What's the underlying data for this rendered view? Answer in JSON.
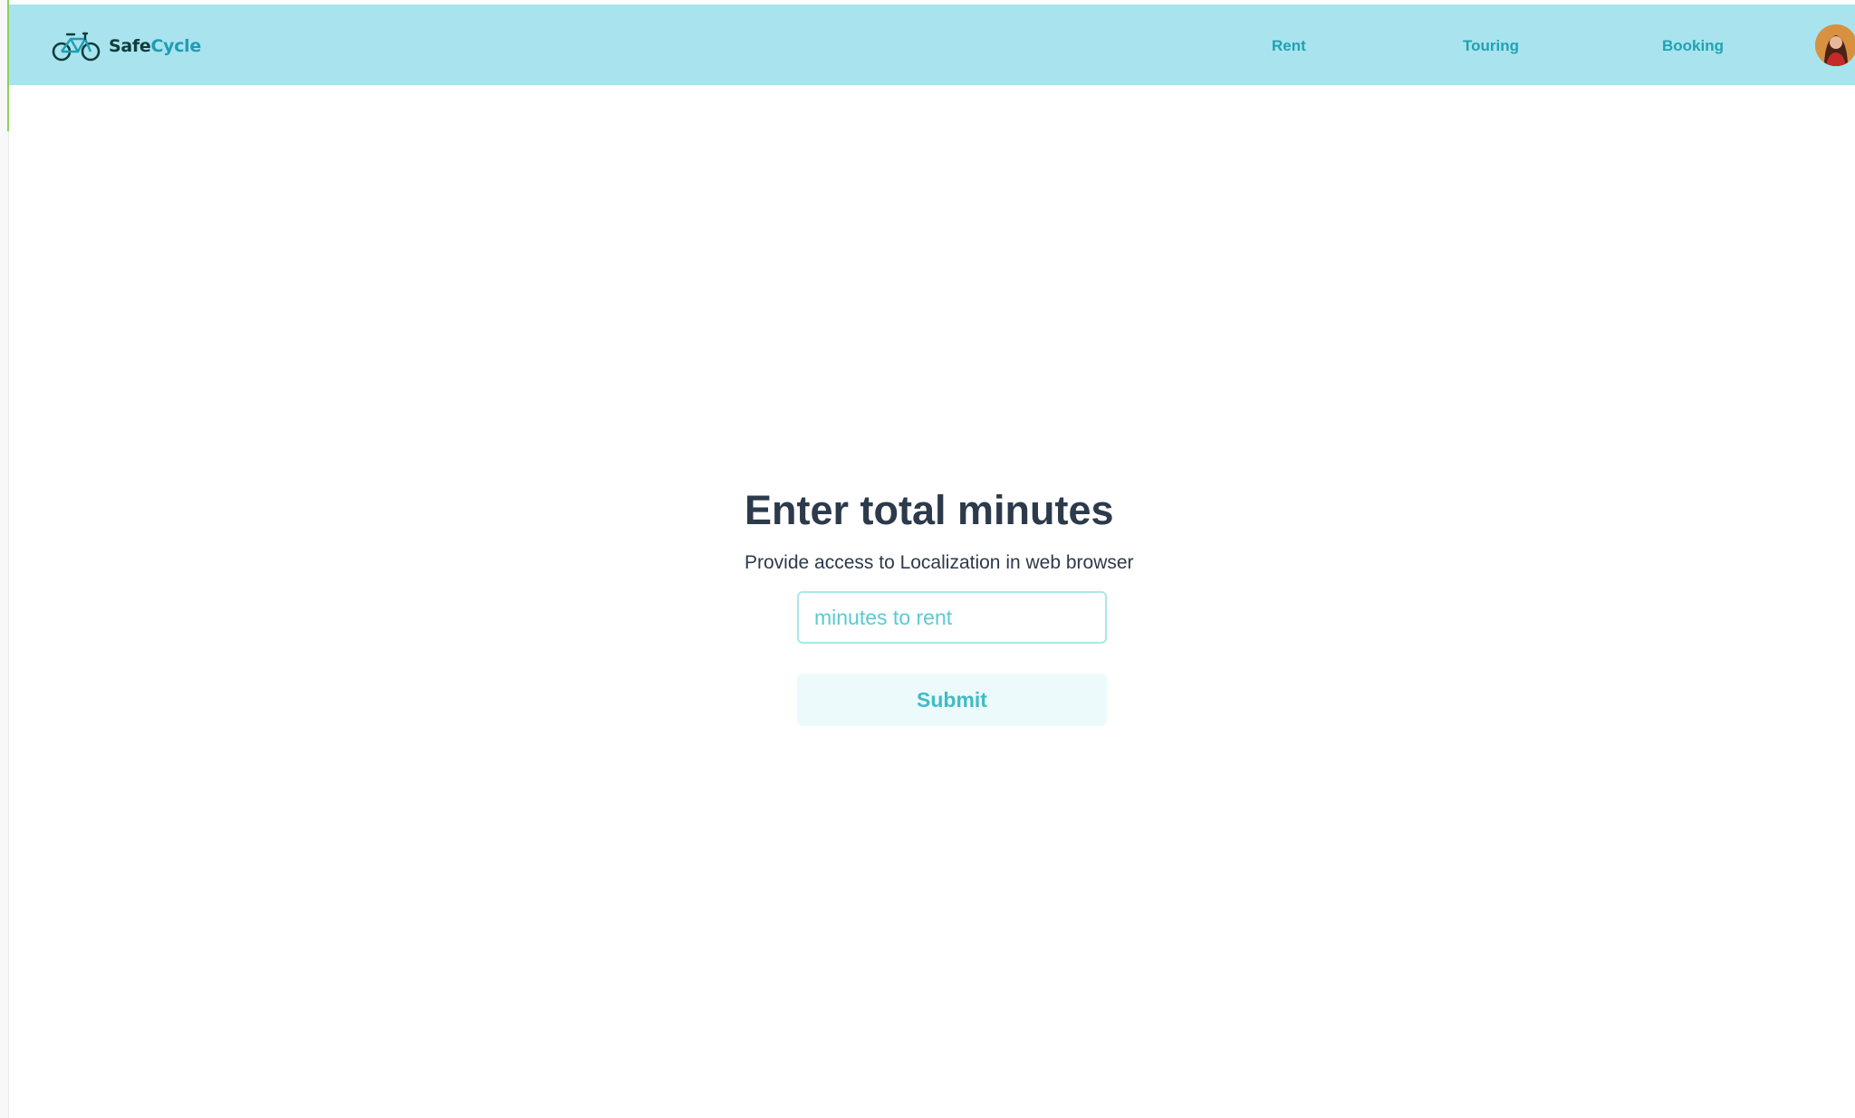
{
  "navbar": {
    "brand": {
      "name_part1": "Safe",
      "name_part2": "Cycle",
      "icon": "bicycle-icon"
    },
    "links": [
      "Rent",
      "Touring",
      "Booking"
    ],
    "avatar": "user-avatar"
  },
  "form": {
    "title": "Enter total minutes",
    "subtitle": "Provide access to Localization in web browser",
    "input_placeholder": "minutes to rent",
    "input_value": "",
    "submit_label": "Submit"
  },
  "colors": {
    "navbar_bg": "#a8e3ee",
    "nav_link": "#1fa3b2",
    "heading": "#2c3a4b",
    "placeholder": "#5cc9d3",
    "input_border": "#a9e7ee",
    "button_bg": "#ecfafc",
    "button_text": "#3fbcc6"
  }
}
